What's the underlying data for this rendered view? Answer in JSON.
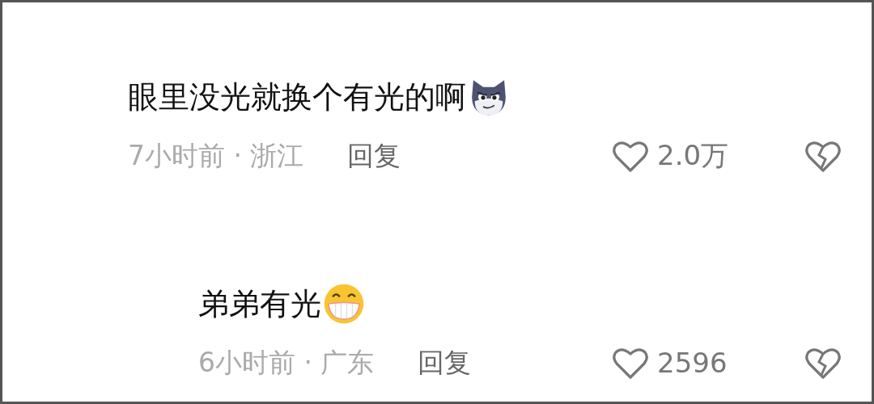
{
  "comments": [
    {
      "text": "眼里没光就换个有光的啊",
      "emoji": {
        "kind": "wolf"
      },
      "meta": "7小时前 · 浙江",
      "reply_label": "回复",
      "likes": "2.0万",
      "children": [
        {
          "text": "弟弟有光",
          "emoji": {
            "kind": "grin"
          },
          "meta": "6小时前 · 广东",
          "reply_label": "回复",
          "likes": "2596"
        }
      ]
    }
  ]
}
